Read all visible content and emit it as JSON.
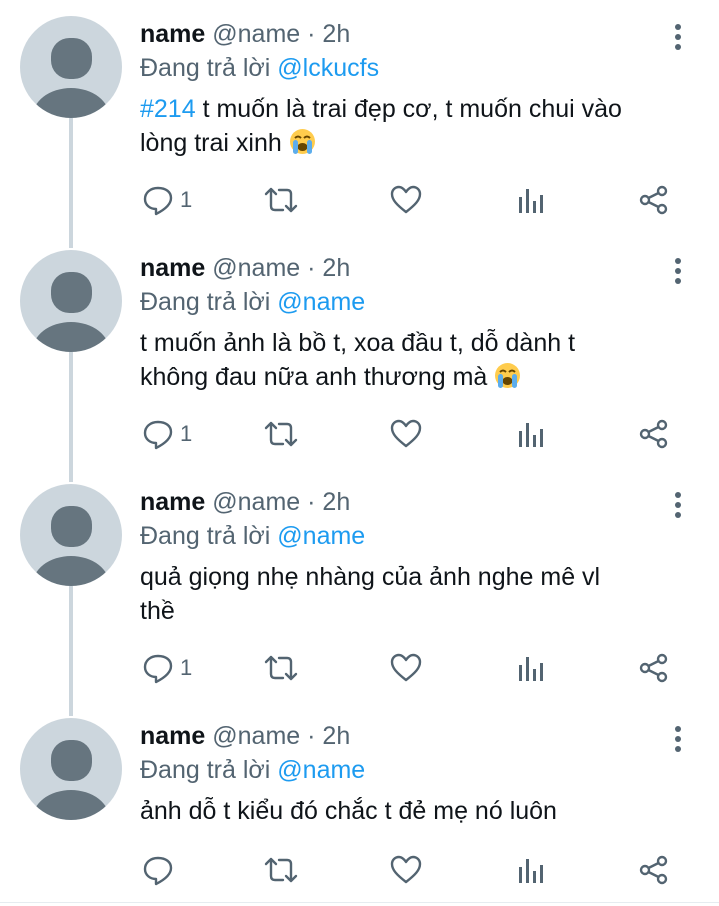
{
  "tweets": [
    {
      "name": "name",
      "handle": "@name",
      "time": "· 2h",
      "reply_prefix": "Đang trả lời ",
      "reply_to": "@lckucfs",
      "hashtag": "#214",
      "text_lines": [
        " t muốn là trai đẹp cơ, t muốn chui vào",
        "lòng trai xinh "
      ],
      "emoji": "crying-face",
      "reply_count": "1"
    },
    {
      "name": "name",
      "handle": "@name",
      "time": "· 2h",
      "reply_prefix": "Đang trả lời ",
      "reply_to": "@name",
      "text_lines": [
        "t muốn ảnh là bồ t, xoa đầu t, dỗ dành t",
        "không đau nữa anh thương mà "
      ],
      "emoji": "crying-face",
      "reply_count": "1"
    },
    {
      "name": "name",
      "handle": "@name",
      "time": "· 2h",
      "reply_prefix": "Đang trả lời ",
      "reply_to": "@name",
      "text_lines": [
        "quả giọng nhẹ nhàng của ảnh nghe mê vl",
        "thề"
      ],
      "reply_count": "1"
    },
    {
      "name": "name",
      "handle": "@name",
      "time": "· 2h",
      "reply_prefix": "Đang trả lời ",
      "reply_to": "@name",
      "text_lines": [
        "ảnh dỗ t kiểu đó chắc t đẻ mẹ nó luôn"
      ],
      "reply_count": ""
    }
  ],
  "icons": {
    "reply": "speech-bubble-icon",
    "retweet": "retweet-arrows-icon",
    "like": "heart-icon",
    "analytics": "bar-chart-icon",
    "share": "share-icon",
    "more": "vertical-ellipsis-icon"
  },
  "colors": {
    "accent": "#1d9bf0",
    "text": "#0f1419",
    "secondary": "#536471",
    "avatar_bg": "#ccd6dd",
    "avatar_fg": "#66757f"
  }
}
